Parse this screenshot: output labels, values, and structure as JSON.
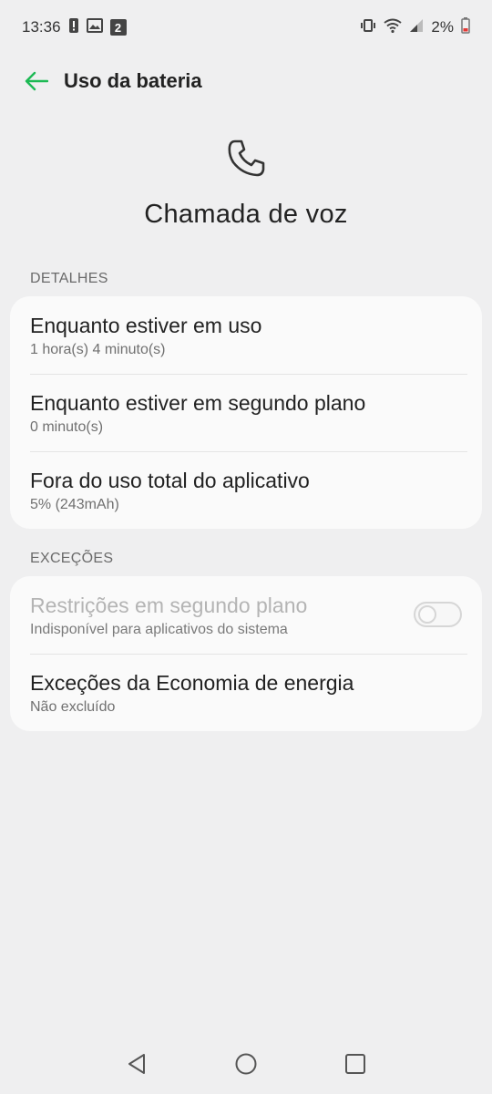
{
  "status_bar": {
    "time": "13:36",
    "notification_count": "2",
    "battery_percent": "2%"
  },
  "app_bar": {
    "title": "Uso da bateria"
  },
  "hero": {
    "icon": "phone-icon",
    "title": "Chamada de voz"
  },
  "details": {
    "label": "DETALHES",
    "items": [
      {
        "title": "Enquanto estiver em uso",
        "subtitle": "1 hora(s) 4 minuto(s)"
      },
      {
        "title": "Enquanto estiver em segundo plano",
        "subtitle": "0 minuto(s)"
      },
      {
        "title": "Fora do uso total do aplicativo",
        "subtitle": "5% (243mAh)"
      }
    ]
  },
  "exceptions": {
    "label": "EXCEÇÕES",
    "items": [
      {
        "title": "Restrições em segundo plano",
        "subtitle": "Indisponível para aplicativos do sistema",
        "toggle_on": false,
        "disabled": true
      },
      {
        "title": "Exceções da Economia de energia",
        "subtitle": "Não excluído"
      }
    ]
  },
  "colors": {
    "accent": "#1db954",
    "background": "#efeff0",
    "card": "#fafafa",
    "battery_low": "#e53935"
  }
}
